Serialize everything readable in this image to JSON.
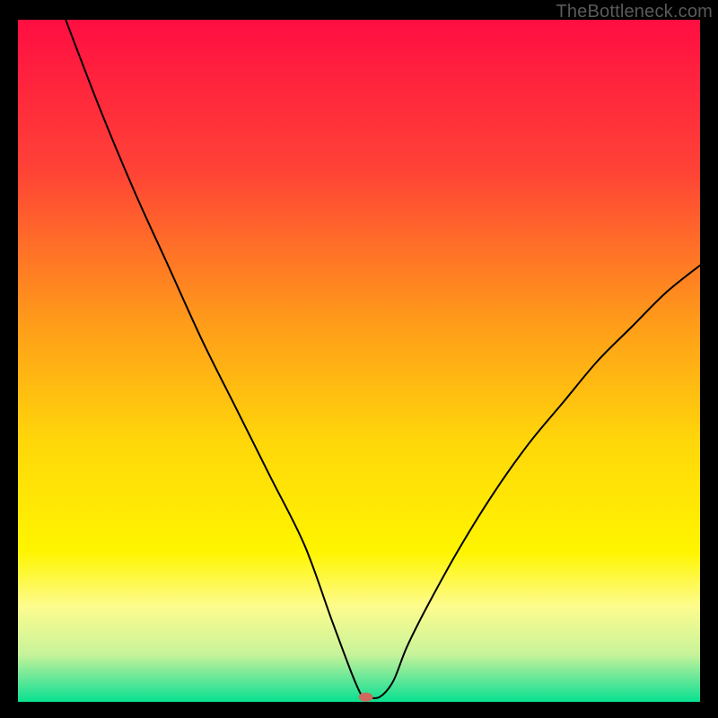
{
  "watermark": "TheBottleneck.com",
  "chart_data": {
    "type": "line",
    "title": "",
    "xlabel": "",
    "ylabel": "",
    "xlim": [
      0,
      100
    ],
    "ylim": [
      0,
      100
    ],
    "grid": false,
    "legend": false,
    "series": [
      {
        "name": "curve",
        "x": [
          7,
          12,
          17,
          22,
          27,
          32,
          37,
          42,
          46,
          49,
          50.5,
          51,
          53,
          55,
          57,
          60,
          65,
          70,
          75,
          80,
          85,
          90,
          95,
          100
        ],
        "y": [
          100,
          87,
          75,
          64,
          53,
          43,
          33,
          23,
          12,
          4,
          0.7,
          0.7,
          0.7,
          3,
          8,
          14,
          23,
          31,
          38,
          44,
          50,
          55,
          60,
          64
        ],
        "stroke": "#000000",
        "stroke_width": 2
      }
    ],
    "background_gradient": {
      "type": "vertical",
      "stops": [
        {
          "offset": 0.0,
          "color": "#ff0e42"
        },
        {
          "offset": 0.22,
          "color": "#ff4236"
        },
        {
          "offset": 0.45,
          "color": "#ff9e19"
        },
        {
          "offset": 0.62,
          "color": "#ffd70a"
        },
        {
          "offset": 0.78,
          "color": "#fff500"
        },
        {
          "offset": 0.86,
          "color": "#fdfc8e"
        },
        {
          "offset": 0.93,
          "color": "#c8f39a"
        },
        {
          "offset": 0.975,
          "color": "#4de597"
        },
        {
          "offset": 1.0,
          "color": "#07e18f"
        }
      ]
    },
    "marker": {
      "x": 51,
      "y": 0.7,
      "color": "#cc6b5d",
      "rx": 8,
      "ry": 5
    }
  }
}
